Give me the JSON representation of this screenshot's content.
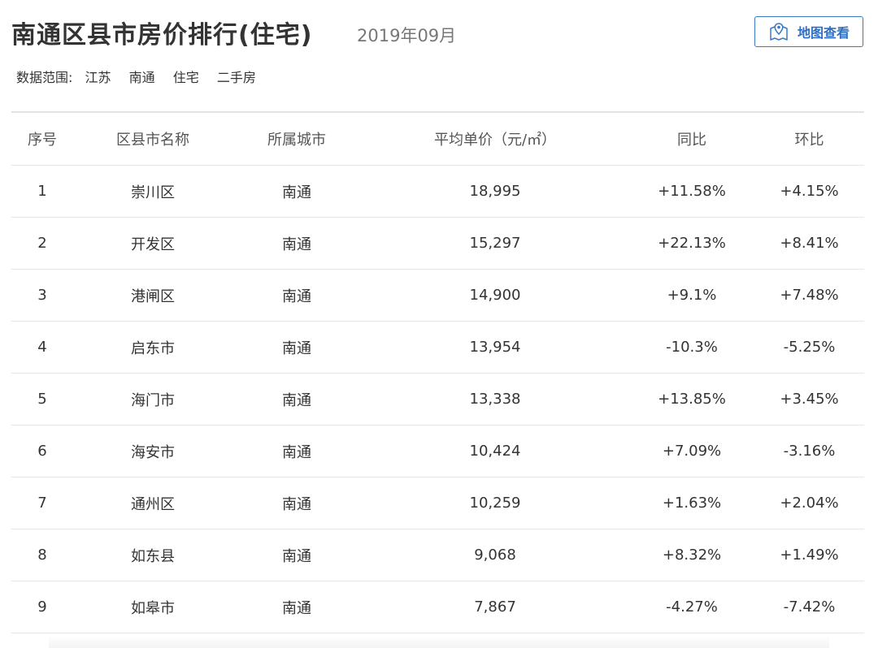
{
  "header": {
    "title": "南通区县市房价排行(住宅)",
    "date": "2019年09月",
    "map_button_label": "地图查看",
    "map_button_icon": "map-pin-icon"
  },
  "filters": {
    "label": "数据范围:",
    "items": [
      "江苏",
      "南通",
      "住宅",
      "二手房"
    ]
  },
  "colors": {
    "accent": "#2f6fc1",
    "increase": "#c9282e",
    "decrease": "#4a8a2a"
  },
  "table": {
    "columns": [
      "序号",
      "区县市名称",
      "所属城市",
      "平均单价（元/㎡）",
      "同比",
      "环比"
    ],
    "rows": [
      {
        "no": "1",
        "name": "崇川区",
        "city": "南通",
        "price": "18,995",
        "yoy": "+11.58%",
        "mom": "+4.15%"
      },
      {
        "no": "2",
        "name": "开发区",
        "city": "南通",
        "price": "15,297",
        "yoy": "+22.13%",
        "mom": "+8.41%"
      },
      {
        "no": "3",
        "name": "港闸区",
        "city": "南通",
        "price": "14,900",
        "yoy": "+9.1%",
        "mom": "+7.48%"
      },
      {
        "no": "4",
        "name": "启东市",
        "city": "南通",
        "price": "13,954",
        "yoy": "-10.3%",
        "mom": "-5.25%"
      },
      {
        "no": "5",
        "name": "海门市",
        "city": "南通",
        "price": "13,338",
        "yoy": "+13.85%",
        "mom": "+3.45%"
      },
      {
        "no": "6",
        "name": "海安市",
        "city": "南通",
        "price": "10,424",
        "yoy": "+7.09%",
        "mom": "-3.16%"
      },
      {
        "no": "7",
        "name": "通州区",
        "city": "南通",
        "price": "10,259",
        "yoy": "+1.63%",
        "mom": "+2.04%"
      },
      {
        "no": "8",
        "name": "如东县",
        "city": "南通",
        "price": "9,068",
        "yoy": "+8.32%",
        "mom": "+1.49%"
      },
      {
        "no": "9",
        "name": "如皋市",
        "city": "南通",
        "price": "7,867",
        "yoy": "-4.27%",
        "mom": "-7.42%"
      }
    ]
  }
}
